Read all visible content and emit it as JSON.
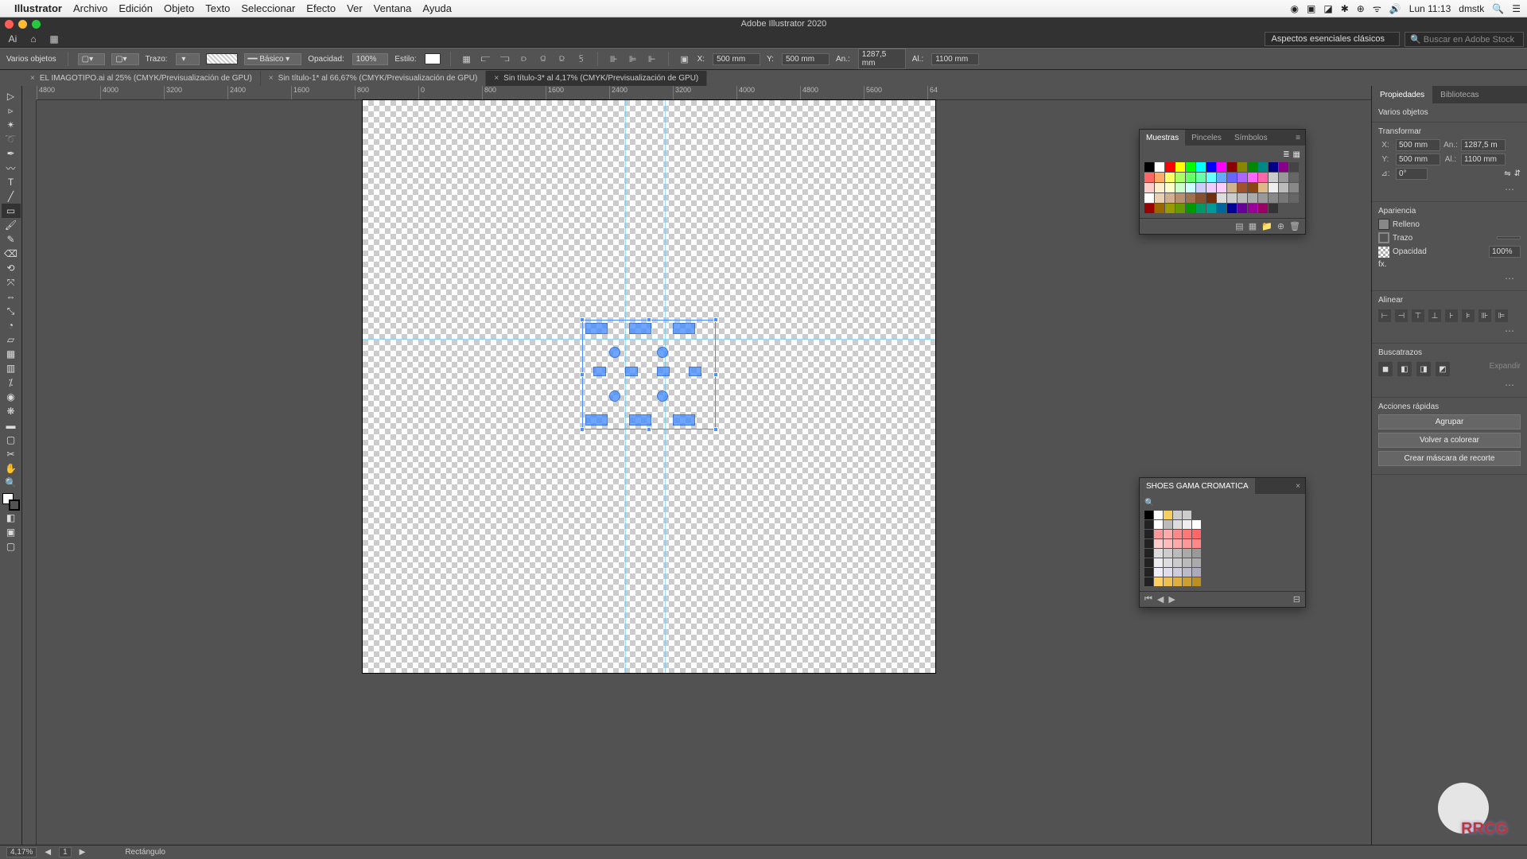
{
  "menubar": {
    "app": "Illustrator",
    "items": [
      "Archivo",
      "Edición",
      "Objeto",
      "Texto",
      "Seleccionar",
      "Efecto",
      "Ver",
      "Ventana",
      "Ayuda"
    ],
    "clock": "Lun 11:13",
    "user": "dmstk"
  },
  "window": {
    "title": "Adobe Illustrator 2020"
  },
  "workspace_dropdown": "Aspectos esenciales clásicos",
  "stock_search_placeholder": "Buscar en Adobe Stock",
  "options_bar": {
    "selection_info": "Varios objetos",
    "trazo_label": "Trazo:",
    "stroke_style": "Básico",
    "opacidad_label": "Opacidad:",
    "opacidad_value": "100%",
    "estilo_label": "Estilo:",
    "x_label": "X:",
    "x_value": "500 mm",
    "y_label": "Y:",
    "y_value": "500 mm",
    "an_label": "An.:",
    "an_value": "1287,5 mm",
    "al_label": "Al.:",
    "al_value": "1100 mm"
  },
  "tabs": [
    {
      "label": "EL IMAGOTIPO.ai al 25% (CMYK/Previsualización de GPU)",
      "active": false
    },
    {
      "label": "Sin título-1* al 66,67% (CMYK/Previsualización de GPU)",
      "active": false
    },
    {
      "label": "Sin título-3* al 4,17% (CMYK/Previsualización de GPU)",
      "active": true
    }
  ],
  "ruler_ticks": [
    "4800",
    "4000",
    "3200",
    "2400",
    "1600",
    "800",
    "0",
    "800",
    "1600",
    "2400",
    "3200",
    "4000",
    "4800",
    "5600",
    "64"
  ],
  "swatches_panel": {
    "tabs": [
      "Muestras",
      "Pinceles",
      "Símbolos"
    ],
    "colors_row1": [
      "#000",
      "#fff",
      "#f00",
      "#ff0",
      "#0f0",
      "#0ff",
      "#00f",
      "#f0f",
      "#800",
      "#880",
      "#080",
      "#088",
      "#008",
      "#808",
      "#444"
    ],
    "colors_row2": [
      "#f66",
      "#fa6",
      "#ff6",
      "#af6",
      "#6f6",
      "#6fa",
      "#6ff",
      "#6af",
      "#66f",
      "#a6f",
      "#f6f",
      "#f6a",
      "#ccc",
      "#999",
      "#666"
    ],
    "colors_row3": [
      "#fcc",
      "#fec",
      "#ffc",
      "#cfc",
      "#cff",
      "#ccf",
      "#ecf",
      "#fcf",
      "#d2b48c",
      "#a0522d",
      "#8b4513",
      "#deb887",
      "#eee",
      "#bbb",
      "#888"
    ],
    "colors_row4": [
      "#fff",
      "#e8d0b0",
      "#d0b090",
      "#b89070",
      "#a07050",
      "#885030",
      "#703010",
      "#ddd",
      "#ccc",
      "#bbb",
      "#aaa",
      "#999",
      "#888",
      "#777",
      "#666"
    ],
    "colors_row5": [
      "#900",
      "#960",
      "#990",
      "#690",
      "#090",
      "#096",
      "#099",
      "#069",
      "#009",
      "#609",
      "#909",
      "#906",
      "#333",
      "",
      ""
    ]
  },
  "shoes_panel": {
    "title": "SHOES GAMA CROMATICA",
    "rows": [
      [
        "#000",
        "#fff",
        "#f5d060",
        "#ccc",
        "#ccc"
      ],
      [
        "#222",
        "#fff",
        "#bbb",
        "#ddd",
        "#eee",
        "#fff"
      ],
      [
        "#222",
        "#f99",
        "#faa",
        "#f88",
        "#f77",
        "#f66"
      ],
      [
        "#222",
        "#fcc",
        "#fbb",
        "#faa",
        "#f99",
        "#f88"
      ],
      [
        "#222",
        "#ddd",
        "#ccc",
        "#bbb",
        "#aaa",
        "#999"
      ],
      [
        "#222",
        "#eee",
        "#ddd",
        "#ccc",
        "#bbb",
        "#aaa"
      ],
      [
        "#222",
        "#eef",
        "#dde",
        "#ccd",
        "#bbc",
        "#aab"
      ],
      [
        "#222",
        "#ffd060",
        "#eec050",
        "#ddb040",
        "#cca030",
        "#bb9020"
      ]
    ]
  },
  "properties": {
    "tabs": [
      "Propiedades",
      "Bibliotecas"
    ],
    "selection": "Varios objetos",
    "transform": {
      "title": "Transformar",
      "x": "500 mm",
      "y": "500 mm",
      "an": "1287,5 m",
      "al": "1100 mm",
      "angle": "0°"
    },
    "appearance": {
      "title": "Apariencia",
      "fill": "Relleno",
      "stroke": "Trazo",
      "opacity_label": "Opacidad",
      "opacity": "100%",
      "fx": "fx."
    },
    "align": {
      "title": "Alinear"
    },
    "pathfinder": {
      "title": "Buscatrazos",
      "expand": "Expandir"
    },
    "quick": {
      "title": "Acciones rápidas",
      "group": "Agrupar",
      "recolor": "Volver a colorear",
      "clip": "Crear máscara de recorte"
    }
  },
  "status": {
    "zoom": "4,17%",
    "artboard": "1",
    "tool": "Rectángulo"
  },
  "watermark": "RRCG"
}
